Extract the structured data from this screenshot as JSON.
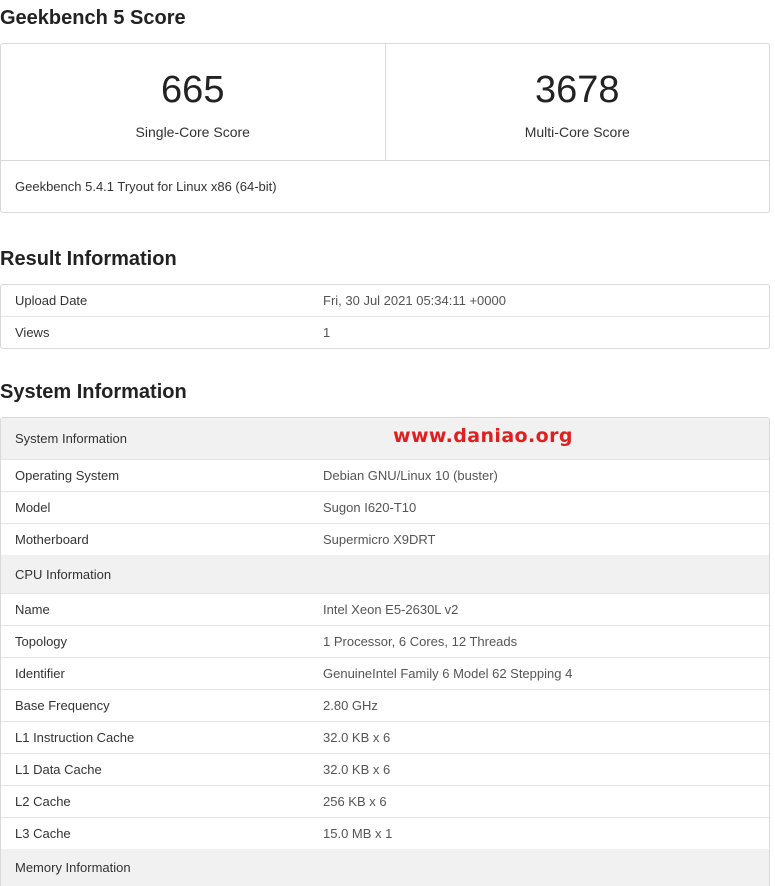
{
  "score_section": {
    "title": "Geekbench 5 Score",
    "single_core": {
      "value": "665",
      "label": "Single-Core Score"
    },
    "multi_core": {
      "value": "3678",
      "label": "Multi-Core Score"
    },
    "version": "Geekbench 5.4.1 Tryout for Linux x86 (64-bit)"
  },
  "result_section": {
    "title": "Result Information",
    "rows": [
      {
        "label": "Upload Date",
        "value": "Fri, 30 Jul 2021 05:34:11 +0000"
      },
      {
        "label": "Views",
        "value": "1"
      }
    ]
  },
  "system_section": {
    "title": "System Information",
    "watermark": "www.daniao.org",
    "groups": [
      {
        "heading": "System Information",
        "rows": [
          {
            "label": "Operating System",
            "value": "Debian GNU/Linux 10 (buster)"
          },
          {
            "label": "Model",
            "value": "Sugon I620-T10"
          },
          {
            "label": "Motherboard",
            "value": "Supermicro X9DRT"
          }
        ]
      },
      {
        "heading": "CPU Information",
        "rows": [
          {
            "label": "Name",
            "value": "Intel Xeon E5-2630L v2"
          },
          {
            "label": "Topology",
            "value": "1 Processor, 6 Cores, 12 Threads"
          },
          {
            "label": "Identifier",
            "value": "GenuineIntel Family 6 Model 62 Stepping 4"
          },
          {
            "label": "Base Frequency",
            "value": "2.80 GHz"
          },
          {
            "label": "L1 Instruction Cache",
            "value": "32.0 KB x 6"
          },
          {
            "label": "L1 Data Cache",
            "value": "32.0 KB x 6"
          },
          {
            "label": "L2 Cache",
            "value": "256 KB x 6"
          },
          {
            "label": "L3 Cache",
            "value": "15.0 MB x 1"
          }
        ]
      },
      {
        "heading": "Memory Information",
        "rows": []
      }
    ]
  },
  "colors": {
    "watermark": "#e0201f",
    "group_bg": "#f1f1f1",
    "border": "#d9d9d9"
  }
}
